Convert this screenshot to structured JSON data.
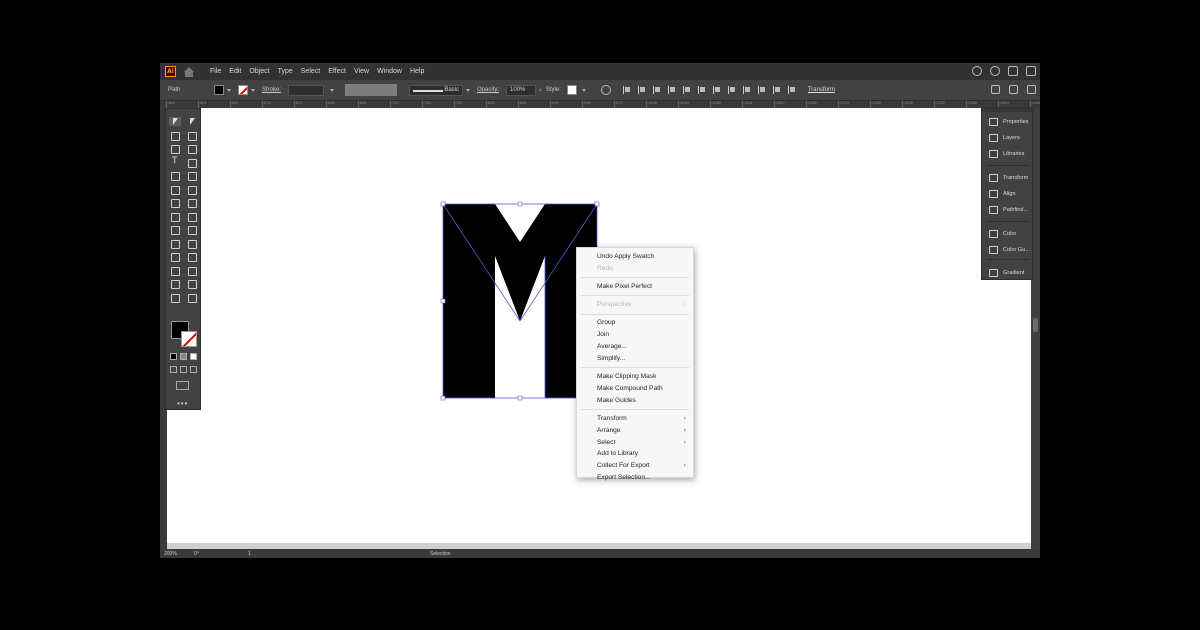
{
  "app": {
    "logo_text": "Ai",
    "menus": [
      "File",
      "Edit",
      "Object",
      "Type",
      "Select",
      "Effect",
      "View",
      "Window",
      "Help"
    ]
  },
  "control_bar": {
    "selection_label": "Path",
    "stroke_label": "Stroke:",
    "brush_label": "Basic",
    "opacity_label": "Opacity:",
    "opacity_value": "100%",
    "style_label": "Style:",
    "transform_label": "Transform"
  },
  "ruler": {
    "ticks": [
      "468",
      "504",
      "540",
      "576",
      "612",
      "648",
      "684",
      "720",
      "756",
      "792",
      "828",
      "864",
      "900",
      "936",
      "972",
      "1008",
      "1044",
      "1080",
      "1116",
      "1152",
      "1188",
      "1224",
      "1260",
      "1296",
      "1332",
      "1368",
      "1404",
      "1440"
    ]
  },
  "context_menu": {
    "groups": [
      [
        {
          "label": "Undo Apply Swatch",
          "disabled": false
        },
        {
          "label": "Redo",
          "disabled": true
        }
      ],
      [
        {
          "label": "Make Pixel Perfect",
          "disabled": false
        }
      ],
      [
        {
          "label": "Perspective",
          "disabled": true,
          "submenu": true
        }
      ],
      [
        {
          "label": "Group",
          "disabled": false
        },
        {
          "label": "Join",
          "disabled": false
        },
        {
          "label": "Average...",
          "disabled": false
        },
        {
          "label": "Simplify...",
          "disabled": false
        }
      ],
      [
        {
          "label": "Make Clipping Mask",
          "disabled": false
        },
        {
          "label": "Make Compound Path",
          "disabled": false
        },
        {
          "label": "Make Guides",
          "disabled": false
        }
      ],
      [
        {
          "label": "Transform",
          "disabled": false,
          "submenu": true
        },
        {
          "label": "Arrange",
          "disabled": false,
          "submenu": true
        },
        {
          "label": "Select",
          "disabled": false,
          "submenu": true
        },
        {
          "label": "Add to Library",
          "disabled": false
        },
        {
          "label": "Collect For Export",
          "disabled": false,
          "submenu": true
        },
        {
          "label": "Export Selection...",
          "disabled": false
        }
      ]
    ]
  },
  "right_panel": {
    "items": [
      "Properties",
      "Layers",
      "Libraries",
      "Transform",
      "Align",
      "Pathfind...",
      "Color",
      "Color Gu...",
      "Gradient"
    ]
  },
  "status_bar": {
    "zoom": "200%",
    "rotation": "0°",
    "artboard_number": "1",
    "tool": "Selection"
  },
  "colors": {
    "fill": "#000000",
    "stroke": "none",
    "selection_outline": "#4a5fd0",
    "accent_logo": "#ff9a00"
  }
}
